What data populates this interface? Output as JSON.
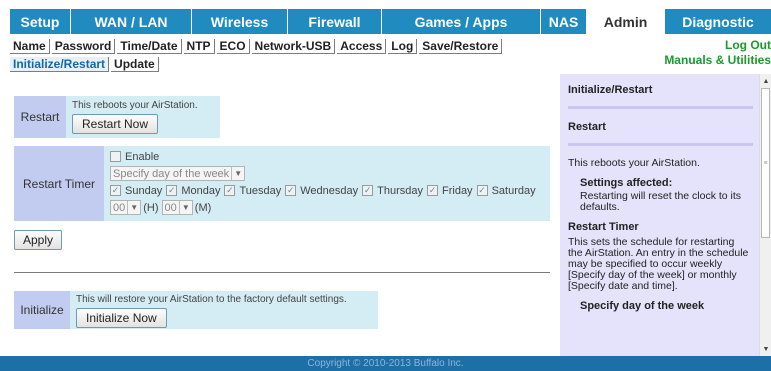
{
  "topnav": {
    "tabs": [
      {
        "label": "Setup",
        "active": false
      },
      {
        "label": "WAN / LAN",
        "active": false
      },
      {
        "label": "Wireless",
        "active": false
      },
      {
        "label": "Firewall",
        "active": false
      },
      {
        "label": "Games / Apps",
        "active": false
      },
      {
        "label": "NAS",
        "active": false
      },
      {
        "label": "Admin",
        "active": true
      },
      {
        "label": "Diagnostic",
        "active": false
      }
    ]
  },
  "subnav": {
    "row1": [
      "Name",
      "Password",
      "Time/Date",
      "NTP",
      "ECO",
      "Network-USB",
      "Access",
      "Log",
      "Save/Restore"
    ],
    "row2": [
      "Initialize/Restart",
      "Update"
    ],
    "logout": "Log Out",
    "manuals": "Manuals & Utilities"
  },
  "restart": {
    "label": "Restart",
    "note": "This reboots your AirStation.",
    "button": "Restart Now"
  },
  "restart_timer": {
    "label": "Restart Timer",
    "enable_label": "Enable",
    "enable_checked": false,
    "mode_select": "Specify day of the week",
    "days": [
      {
        "label": "Sunday",
        "checked": true
      },
      {
        "label": "Monday",
        "checked": true
      },
      {
        "label": "Tuesday",
        "checked": true
      },
      {
        "label": "Wednesday",
        "checked": true
      },
      {
        "label": "Thursday",
        "checked": true
      },
      {
        "label": "Friday",
        "checked": true
      },
      {
        "label": "Saturday",
        "checked": true
      }
    ],
    "hour_value": "00",
    "hour_unit": "(H)",
    "minute_value": "00",
    "minute_unit": "(M)"
  },
  "apply_button": "Apply",
  "initialize": {
    "label": "Initialize",
    "note": "This will restore your AirStation to the factory default settings.",
    "button": "Initialize Now"
  },
  "help": {
    "title": "Initialize/Restart",
    "restart_heading": "Restart",
    "restart_text": "This reboots your AirStation.",
    "settings_affected": "Settings affected:",
    "settings_text": "Restarting will reset the clock to its defaults.",
    "timer_heading": "Restart Timer",
    "timer_text": "This sets the schedule for restarting the AirStation. An entry in the schedule may be specified to occur weekly [Specify day of the week] or monthly [Specify date and time].",
    "day_heading": "Specify day of the week"
  },
  "footer": "Copyright © 2010-2013 Buffalo Inc.",
  "colors": {
    "nav": "#1f8bbf",
    "section_bg": "#d4ecf4",
    "label_bg": "#c2ccf0",
    "help_bg": "#e4e3fb",
    "footer": "#1d6fa8",
    "links_green": "#1a9a2a"
  }
}
